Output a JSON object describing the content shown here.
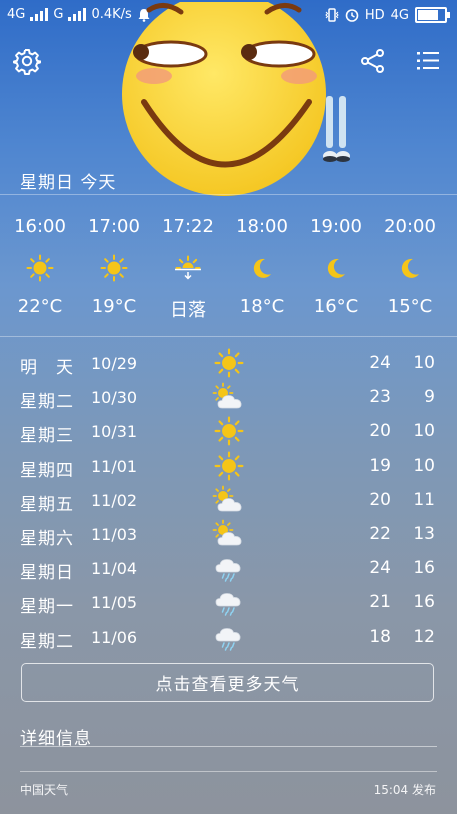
{
  "status_bar": {
    "network_1": "4G",
    "network_2": "G",
    "speed": "0.4K/s",
    "hd_label": "HD",
    "network_3": "4G",
    "battery_level": 0.85
  },
  "header": {
    "settings_icon": "gear-icon",
    "share_icon": "share-icon",
    "menu_icon": "list-menu-icon"
  },
  "today": {
    "heading": "星期日  今天"
  },
  "hourly": [
    {
      "time": "16:00",
      "icon": "sun-icon",
      "value": "22°C"
    },
    {
      "time": "17:00",
      "icon": "sun-icon",
      "value": "19°C"
    },
    {
      "time": "17:22",
      "icon": "sunset-icon",
      "value": "日落"
    },
    {
      "time": "18:00",
      "icon": "moon-icon",
      "value": "18°C"
    },
    {
      "time": "19:00",
      "icon": "moon-icon",
      "value": "16°C"
    },
    {
      "time": "20:00",
      "icon": "moon-icon",
      "value": "15°C"
    }
  ],
  "daily": [
    {
      "name": "明　天",
      "date": "10/29",
      "icon": "sun-icon",
      "high": "24",
      "low": "10"
    },
    {
      "name": "星期二",
      "date": "10/30",
      "icon": "partly-cloudy-icon",
      "high": "23",
      "low": "9"
    },
    {
      "name": "星期三",
      "date": "10/31",
      "icon": "sun-icon",
      "high": "20",
      "low": "10"
    },
    {
      "name": "星期四",
      "date": "11/01",
      "icon": "sun-icon",
      "high": "19",
      "low": "10"
    },
    {
      "name": "星期五",
      "date": "11/02",
      "icon": "partly-cloudy-icon",
      "high": "20",
      "low": "11"
    },
    {
      "name": "星期六",
      "date": "11/03",
      "icon": "partly-cloudy-icon",
      "high": "22",
      "low": "13"
    },
    {
      "name": "星期日",
      "date": "11/04",
      "icon": "rain-cloud-icon",
      "high": "24",
      "low": "16"
    },
    {
      "name": "星期一",
      "date": "11/05",
      "icon": "rain-cloud-icon",
      "high": "21",
      "low": "16"
    },
    {
      "name": "星期二",
      "date": "11/06",
      "icon": "rain-cloud-icon",
      "high": "18",
      "low": "12"
    }
  ],
  "more_button_label": "点击查看更多天气",
  "details_label": "详细信息",
  "footer": {
    "source": "中国天气",
    "published": "15:04 发布"
  },
  "colors": {
    "sun": "#f5c518",
    "moon": "#f5c518",
    "emoji_face": "#f7d53a",
    "emoji_outline": "#7a3a10"
  }
}
